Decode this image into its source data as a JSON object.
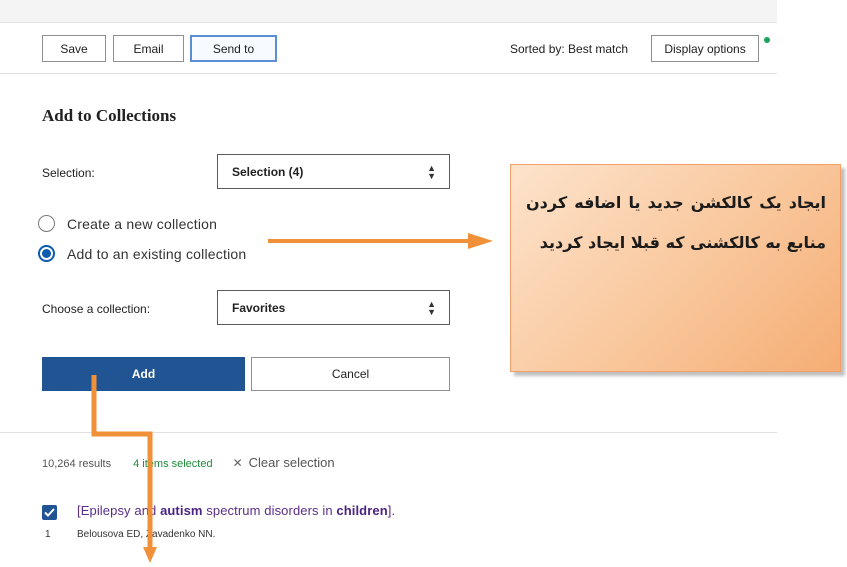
{
  "toolbar": {
    "save_label": "Save",
    "email_label": "Email",
    "send_to_label": "Send to",
    "sorted_label": "Sorted by: Best match",
    "display_options_label": "Display options"
  },
  "collections_panel": {
    "title": "Add to Collections",
    "selection_label": "Selection:",
    "selection_value": "Selection (4)",
    "radio_create_label": "Create a new collection",
    "radio_existing_label": "Add to an existing collection",
    "radio_selected": "existing",
    "choose_label": "Choose a collection:",
    "choose_value": "Favorites",
    "add_label": "Add",
    "cancel_label": "Cancel"
  },
  "results": {
    "count": "10,264 results",
    "selected": "4 items selected",
    "clear": "Clear selection",
    "items": [
      {
        "number": "1",
        "title_parts": [
          "[Epilepsy and ",
          "autism",
          " spectrum disorders in ",
          "children",
          "]."
        ],
        "authors": "Belousova ED, Zavadenko NN.",
        "checked": true
      }
    ]
  },
  "annotation": {
    "text": "ایجاد یک کالکشن جدید یا اضافه کردن منابع به کالکشنی که قبلا ایجاد کردید"
  },
  "colors": {
    "primary": "#205493",
    "arrow": "#f0913a",
    "selected_green": "#1f8a3b",
    "link_purple": "#5a2d8a"
  }
}
